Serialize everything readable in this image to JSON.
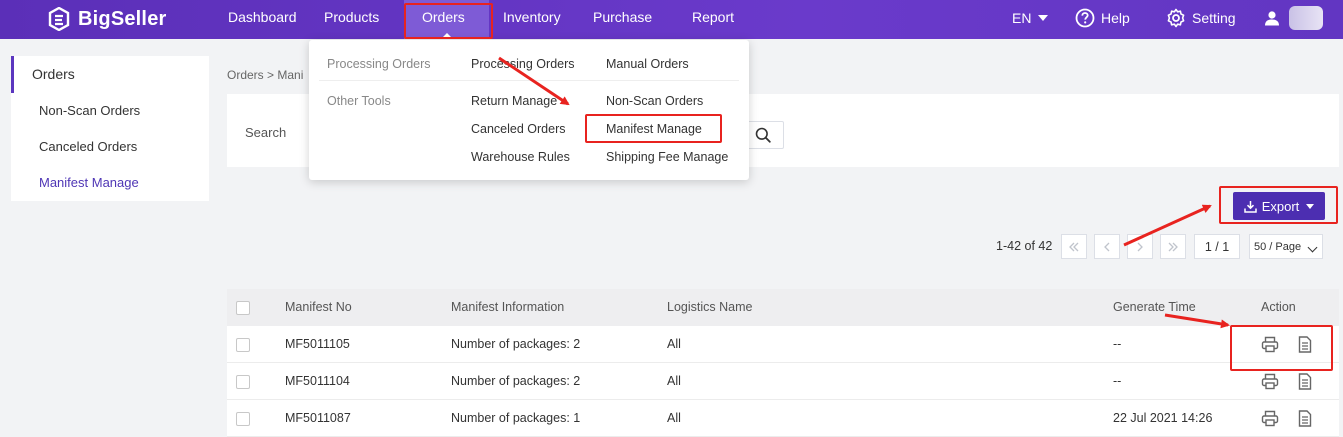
{
  "brand": {
    "name": "BigSeller"
  },
  "nav": {
    "items": [
      "Dashboard",
      "Products",
      "Orders",
      "Inventory",
      "Purchase",
      "Report"
    ],
    "language": "EN",
    "help": "Help",
    "setting": "Setting"
  },
  "dropdown": {
    "group_processing": "Processing Orders",
    "group_tools": "Other Tools",
    "processing_orders": "Processing Orders",
    "manual_orders": "Manual Orders",
    "return_manage": "Return Manage",
    "non_scan_orders": "Non-Scan Orders",
    "canceled_orders": "Canceled Orders",
    "manifest_manage": "Manifest Manage",
    "warehouse_rules": "Warehouse Rules",
    "shipping_fee_manage": "Shipping Fee Manage"
  },
  "sidebar": {
    "heading": "Orders",
    "items": [
      "Non-Scan Orders",
      "Canceled Orders",
      "Manifest Manage"
    ]
  },
  "breadcrumb": {
    "text": "Orders > Mani"
  },
  "search": {
    "label": "Search"
  },
  "toolbar": {
    "export_label": "Export"
  },
  "pagination": {
    "total": "1-42 of 42",
    "page": "1 / 1",
    "page_size": "50 / Page"
  },
  "table": {
    "headers": {
      "manifest_no": "Manifest No",
      "manifest_info": "Manifest Information",
      "logistics": "Logistics Name",
      "generate_time": "Generate Time",
      "action": "Action"
    },
    "rows": [
      {
        "manifest_no": "MF5011105",
        "info": "Number of packages: 2",
        "logistics": "All",
        "time": "--"
      },
      {
        "manifest_no": "MF5011104",
        "info": "Number of packages: 2",
        "logistics": "All",
        "time": "--"
      },
      {
        "manifest_no": "MF5011087",
        "info": "Number of packages: 1",
        "logistics": "All",
        "time": "22 Jul 2021 14:26"
      }
    ]
  },
  "colors": {
    "nav_bg": "#5b2fb8",
    "accent": "#4c2eb1",
    "annotation": "#e8231f"
  },
  "icons": [
    "bigseller-logo",
    "caret-down-icon",
    "help-icon",
    "gear-icon",
    "user-icon",
    "search-icon",
    "download-icon",
    "printer-icon",
    "document-icon"
  ]
}
